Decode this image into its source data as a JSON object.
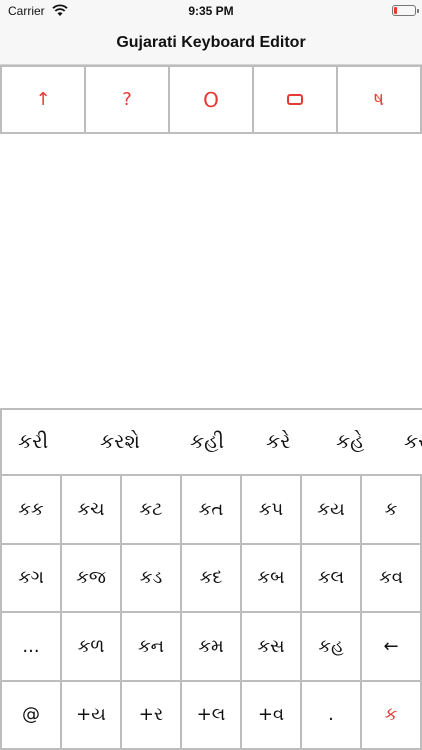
{
  "status_bar": {
    "carrier": "Carrier",
    "time": "9:35 PM"
  },
  "nav": {
    "title": "Gujarati Keyboard Editor"
  },
  "toolbar": {
    "buttons": [
      {
        "label": "↑",
        "icon": "arrow-up-icon"
      },
      {
        "label": "?",
        "icon": "question-icon"
      },
      {
        "label": "O",
        "icon": "circle-letter-icon"
      },
      {
        "label": "",
        "icon": "rounded-rect-icon"
      },
      {
        "label": "ષ",
        "icon": "gujarati-ssa-icon"
      }
    ]
  },
  "suggestions": [
    "કરી",
    "કરશે",
    "કહી",
    "કરે",
    "કહે",
    "કરી"
  ],
  "keyboard": {
    "rows": [
      [
        "કક",
        "કચ",
        "કટ",
        "કત",
        "કપ",
        "કય",
        "ક"
      ],
      [
        "કગ",
        "કજ",
        "કડ",
        "કદ",
        "કબ",
        "કલ",
        "કવ"
      ],
      [
        "...",
        "કળ",
        "કન",
        "કમ",
        "કસ",
        "કહ",
        "←"
      ],
      [
        "@",
        "+ય",
        "+ર",
        "+લ",
        "+વ",
        ".",
        "ક"
      ]
    ]
  },
  "colors": {
    "accent": "#e53935",
    "border": "#bdbdbd",
    "bar_bg": "#f7f7f7"
  }
}
